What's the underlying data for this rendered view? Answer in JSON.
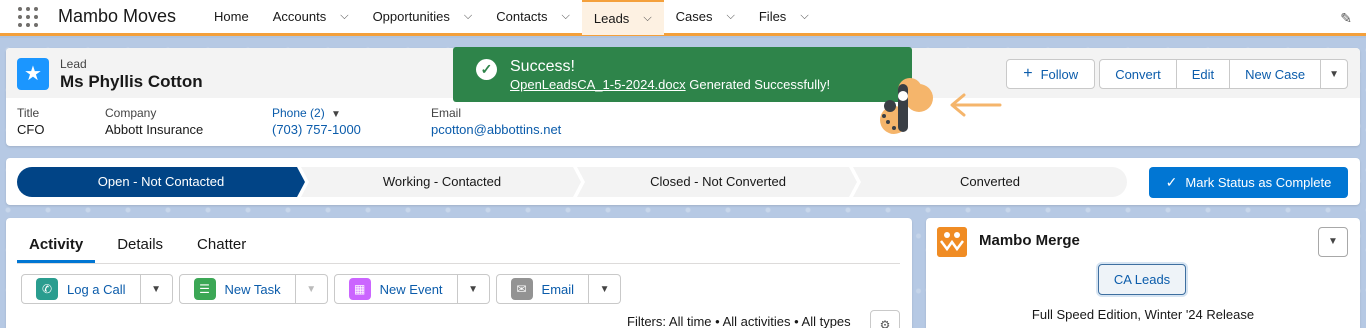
{
  "nav": {
    "app_name": "Mambo Moves",
    "items": [
      {
        "label": "Home",
        "dropdown": false
      },
      {
        "label": "Accounts",
        "dropdown": true
      },
      {
        "label": "Opportunities",
        "dropdown": true
      },
      {
        "label": "Contacts",
        "dropdown": true
      },
      {
        "label": "Leads",
        "dropdown": true,
        "active": true
      },
      {
        "label": "Cases",
        "dropdown": true
      },
      {
        "label": "Files",
        "dropdown": true
      }
    ],
    "accent_color": "#f4a03b"
  },
  "record": {
    "type": "Lead",
    "name": "Ms Phyllis Cotton",
    "buttons": {
      "follow": "Follow",
      "convert": "Convert",
      "edit": "Edit",
      "new_case": "New Case"
    },
    "fields": [
      {
        "label": "Title",
        "value": "CFO",
        "link": false
      },
      {
        "label": "Company",
        "value": "Abbott Insurance",
        "link": false
      },
      {
        "label": "Phone (2)",
        "value": "(703) 757-1000",
        "link": true
      },
      {
        "label": "Email",
        "value": "pcotton@abbottins.net",
        "link": true
      }
    ]
  },
  "toast": {
    "title": "Success!",
    "file_link": "OpenLeadsCA_1-5-2024.docx",
    "message": " Generated Successfully!",
    "color": "#2e844a"
  },
  "path": {
    "stages": [
      "Open - Not Contacted",
      "Working - Contacted",
      "Closed - Not Converted",
      "Converted"
    ],
    "active_index": 0,
    "mark_button": "Mark Status as Complete",
    "active_color": "#014486"
  },
  "activity": {
    "tabs": [
      "Activity",
      "Details",
      "Chatter"
    ],
    "active_tab": "Activity",
    "actions": [
      {
        "label": "Log a Call",
        "icon": "phone-icon",
        "color": "#2a9d8f"
      },
      {
        "label": "New Task",
        "icon": "task-icon",
        "color": "#3ba755"
      },
      {
        "label": "New Event",
        "icon": "calendar-icon",
        "color": "#cb65ff"
      },
      {
        "label": "Email",
        "icon": "email-icon",
        "color": "#939393"
      }
    ],
    "filters": "Filters: All time • All activities • All types"
  },
  "merge": {
    "title": "Mambo Merge",
    "button": "CA Leads",
    "edition": "Full Speed Edition, Winter '24 Release"
  }
}
